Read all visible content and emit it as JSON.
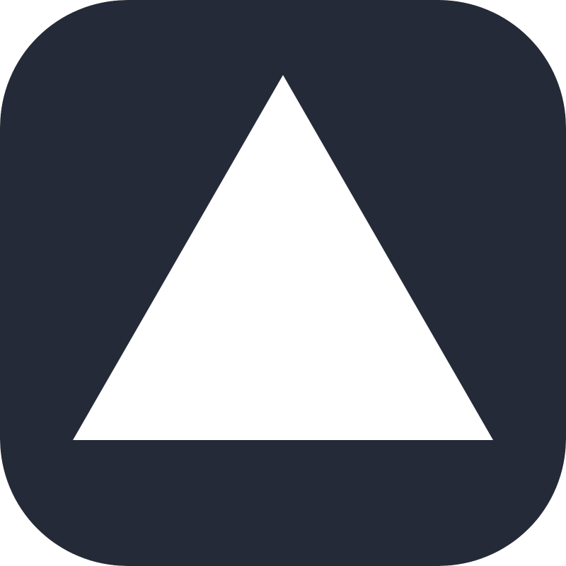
{
  "icon": {
    "name": "triangle-icon",
    "background_color": "#252a38",
    "glyph_color": "#ffffff"
  }
}
